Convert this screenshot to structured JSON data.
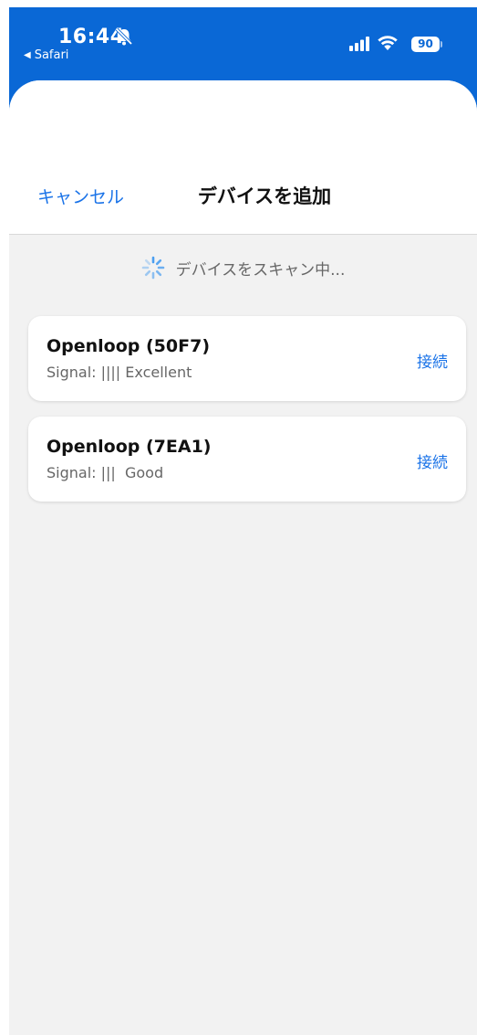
{
  "status_bar": {
    "time": "16:44",
    "back_app": "Safari",
    "battery": "90"
  },
  "sheet": {
    "cancel_label": "キャンセル",
    "title": "デバイスを追加",
    "scan_text": "デバイスをスキャン中..."
  },
  "devices": [
    {
      "name": "Openloop (50F7)",
      "signal": "Signal: |||| Excellent",
      "connect_label": "接続"
    },
    {
      "name": "Openloop (7EA1)",
      "signal": "Signal: |||  Good",
      "connect_label": "接続"
    }
  ],
  "colors": {
    "accent": "#1a73e8",
    "status_bar_bg": "#0a68d6",
    "sheet_bg": "#f2f2f2"
  },
  "icons": [
    "bell-slash-icon",
    "back-arrow-icon",
    "cellular-signal-icon",
    "wifi-icon",
    "battery-icon",
    "spinner-icon"
  ]
}
